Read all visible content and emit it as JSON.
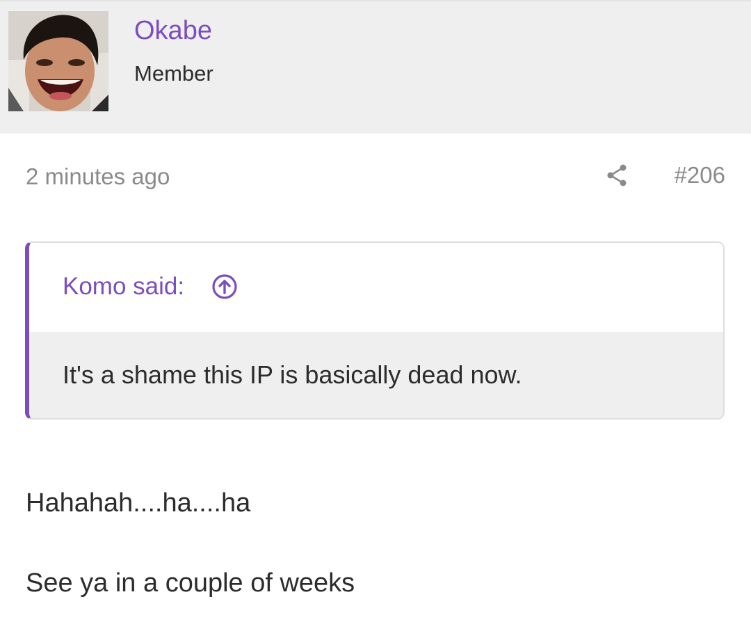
{
  "user": {
    "name": "Okabe",
    "title": "Member"
  },
  "post": {
    "timestamp": "2 minutes ago",
    "number": "#206",
    "quote": {
      "author_label": "Komo said:",
      "text": "It's a shame this IP is basically dead now."
    },
    "message_lines": [
      "Hahahah....ha....ha",
      "See ya in a couple of weeks"
    ]
  },
  "icons": {
    "share": "share-icon",
    "quote_jump": "arrow-up-circle-icon"
  },
  "colors": {
    "accent": "#7c4dbe",
    "header_bg": "#efefef",
    "muted_text": "#8a8a8a",
    "body_text": "#2c2c2c"
  }
}
